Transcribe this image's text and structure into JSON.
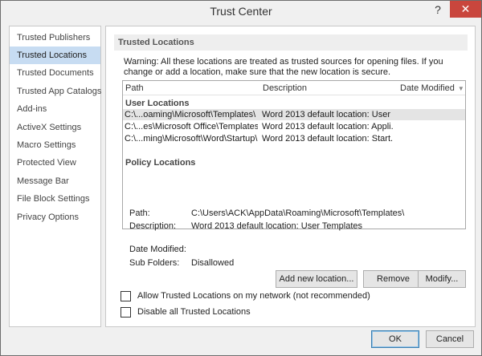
{
  "window": {
    "title": "Trust Center",
    "help_glyph": "?",
    "close_glyph": "✕"
  },
  "sidebar": {
    "items": [
      {
        "label": "Trusted Publishers"
      },
      {
        "label": "Trusted Locations",
        "selected": true
      },
      {
        "label": "Trusted Documents"
      },
      {
        "label": "Trusted App Catalogs"
      },
      {
        "label": "Add-ins"
      },
      {
        "label": "ActiveX Settings"
      },
      {
        "label": "Macro Settings"
      },
      {
        "label": "Protected View"
      },
      {
        "label": "Message Bar"
      },
      {
        "label": "File Block Settings"
      },
      {
        "label": "Privacy Options"
      }
    ]
  },
  "main": {
    "section_title": "Trusted Locations",
    "warning": "Warning: All these locations are treated as trusted sources for opening files.  If you change or add a location, make sure that the new location is secure.",
    "table": {
      "columns": {
        "path": "Path",
        "description": "Description",
        "date_modified": "Date Modified"
      },
      "user_group": "User Locations",
      "rows": [
        {
          "path": "C:\\...oaming\\Microsoft\\Templates\\",
          "description": "Word 2013 default location: User ...",
          "selected": true
        },
        {
          "path": "C:\\...es\\Microsoft Office\\Templates\\",
          "description": "Word 2013 default location: Appli..."
        },
        {
          "path": "C:\\...ming\\Microsoft\\Word\\Startup\\",
          "description": "Word 2013 default location: Start..."
        }
      ],
      "policy_group": "Policy Locations"
    },
    "details": {
      "path_label": "Path:",
      "path_value": "C:\\Users\\ACK\\AppData\\Roaming\\Microsoft\\Templates\\",
      "description_label": "Description:",
      "description_value": "Word 2013 default location: User Templates",
      "date_label": "Date Modified:",
      "subfolders_label": "Sub Folders:",
      "subfolders_value": "Disallowed"
    },
    "buttons": {
      "add": "Add new location...",
      "remove": "Remove",
      "modify": "Modify..."
    },
    "checkboxes": {
      "allow_network": {
        "label": "Allow Trusted Locations on my network (not recommended)",
        "checked": false
      },
      "disable_all": {
        "label": "Disable all Trusted Locations",
        "checked": false
      }
    }
  },
  "footer": {
    "ok": "OK",
    "cancel": "Cancel"
  }
}
